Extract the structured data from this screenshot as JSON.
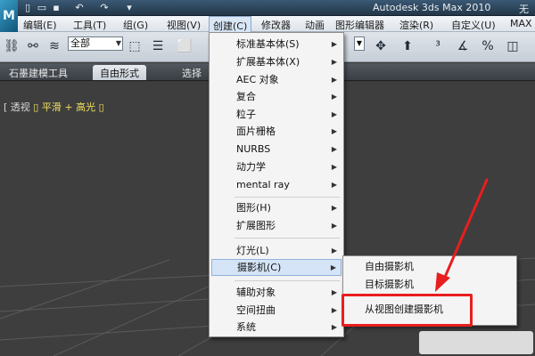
{
  "window": {
    "title": "Autodesk 3ds Max  2010",
    "title_extra": "无"
  },
  "menubar": {
    "items": [
      "编辑(E)",
      "工具(T)",
      "组(G)",
      "视图(V)",
      "创建(C)",
      "修改器",
      "动画",
      "图形编辑器",
      "渲染(R)",
      "自定义(U)",
      "MAX"
    ]
  },
  "toolbar": {
    "selection_filter": "全部"
  },
  "ribbon": {
    "tabs": [
      "石墨建模工具",
      "自由形式",
      "选择"
    ]
  },
  "viewport": {
    "label_bracket_open": "[",
    "label_view": "透视",
    "label_shading": "平滑 + 高光",
    "label_bracket_close": "]"
  },
  "create_menu": {
    "items": [
      "标准基本体(S)",
      "扩展基本体(X)",
      "AEC 对象",
      "复合",
      "粒子",
      "面片栅格",
      "NURBS",
      "动力学",
      "mental ray",
      "图形(H)",
      "扩展图形",
      "灯光(L)",
      "摄影机(C)",
      "辅助对象",
      "空间扭曲",
      "系统"
    ],
    "highlighted": "摄影机(C)"
  },
  "camera_submenu": {
    "items": [
      "自由摄影机",
      "目标摄影机",
      "从视图创建摄影机"
    ]
  },
  "colors": {
    "annotation": "#e81e1e",
    "highlight": "#d5e4f6"
  }
}
